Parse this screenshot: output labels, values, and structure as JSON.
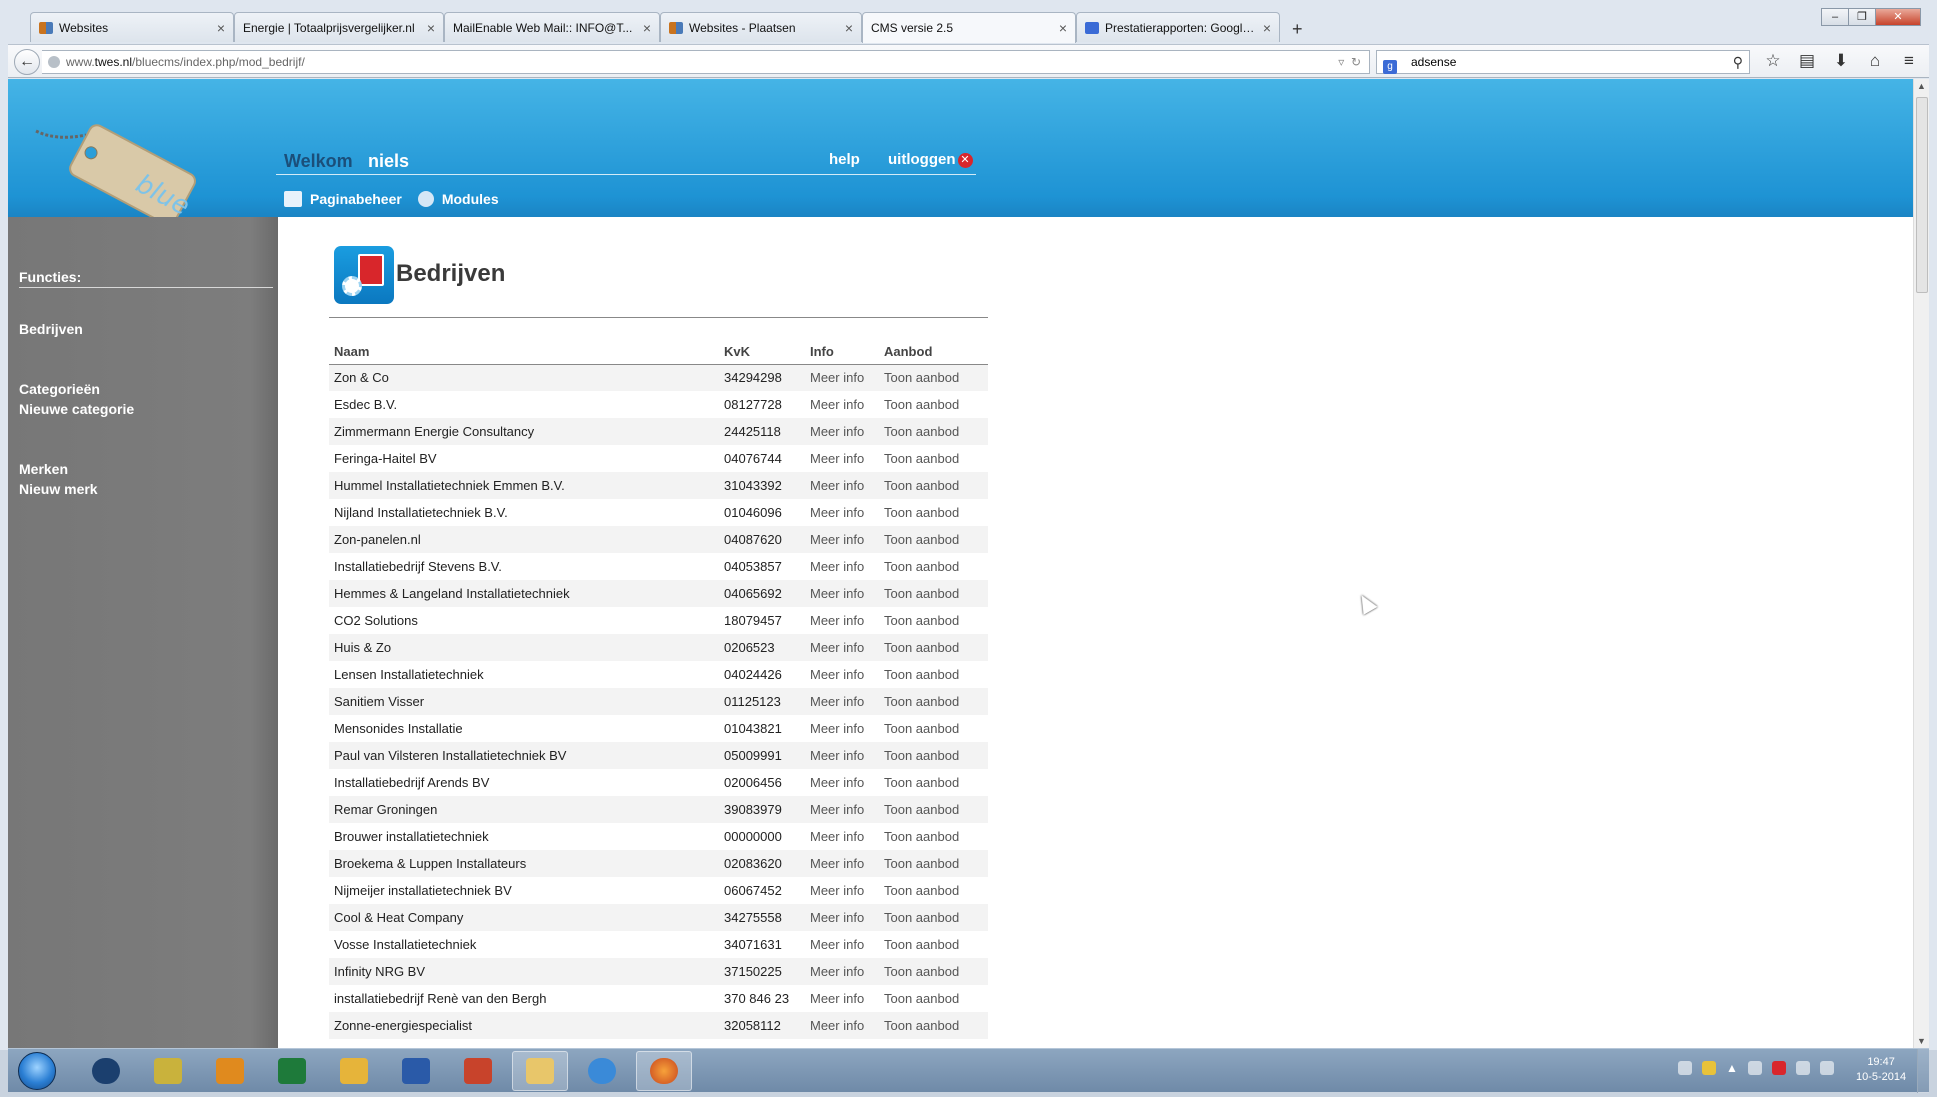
{
  "browser": {
    "tabs": [
      {
        "label": "Websites",
        "icon": "sites-favicon-icon",
        "active": false
      },
      {
        "label": "Energie | Totaalprijsvergelijker.nl",
        "icon": "",
        "active": false
      },
      {
        "label": "MailEnable Web Mail:: INFO@T...",
        "icon": "",
        "active": false
      },
      {
        "label": "Websites - Plaatsen",
        "icon": "sites-favicon-icon",
        "active": false
      },
      {
        "label": "CMS versie 2.5",
        "icon": "",
        "active": true
      },
      {
        "label": "Prestatierapporten: Google...",
        "icon": "google-favicon-icon",
        "active": false
      }
    ],
    "url_prefix": "www.",
    "url_domain": "twes.nl",
    "url_path": "/bluecms/index.php/mod_bedrijf/",
    "search_value": "adsense"
  },
  "cms": {
    "welcome_label": "Welkom",
    "user_name": "niels",
    "help_label": "help",
    "logout_label": "uitloggen",
    "nav": [
      {
        "label": "Paginabeheer",
        "icon": "pages-icon"
      },
      {
        "label": "Modules",
        "icon": "modules-gear-icon"
      }
    ],
    "sidebar": {
      "heading": "Functies:",
      "links": [
        "Bedrijven",
        "Categorieën",
        "Nieuwe categorie",
        "Merken",
        "Nieuw merk"
      ]
    },
    "page_title": "Bedrijven",
    "table": {
      "columns": [
        "Naam",
        "KvK",
        "Info",
        "Aanbod"
      ],
      "info_link": "Meer info",
      "offer_link": "Toon aanbod",
      "rows": [
        {
          "name": "Zon & Co",
          "kvk": "34294298"
        },
        {
          "name": "Esdec B.V.",
          "kvk": "08127728"
        },
        {
          "name": "Zimmermann Energie Consultancy",
          "kvk": "24425118"
        },
        {
          "name": "Feringa-Haitel BV",
          "kvk": "04076744"
        },
        {
          "name": "Hummel Installatietechniek Emmen B.V.",
          "kvk": "31043392"
        },
        {
          "name": "Nijland Installatietechniek B.V.",
          "kvk": "01046096"
        },
        {
          "name": "Zon-panelen.nl",
          "kvk": "04087620"
        },
        {
          "name": "Installatiebedrijf Stevens B.V.",
          "kvk": "04053857"
        },
        {
          "name": "Hemmes & Langeland Installatietechniek",
          "kvk": "04065692"
        },
        {
          "name": "CO2 Solutions",
          "kvk": "18079457"
        },
        {
          "name": "Huis & Zo",
          "kvk": "0206523"
        },
        {
          "name": "Lensen Installatietechniek",
          "kvk": "04024426"
        },
        {
          "name": "Sanitiem Visser",
          "kvk": "01125123"
        },
        {
          "name": "Mensonides Installatie",
          "kvk": "01043821"
        },
        {
          "name": "Paul van Vilsteren Installatietechniek BV",
          "kvk": "05009991"
        },
        {
          "name": "Installatiebedrijf Arends BV",
          "kvk": "02006456"
        },
        {
          "name": "Remar Groningen",
          "kvk": "39083979"
        },
        {
          "name": "Brouwer installatietechniek",
          "kvk": "00000000"
        },
        {
          "name": "Broekema & Luppen Installateurs",
          "kvk": "02083620"
        },
        {
          "name": "Nijmeijer installatietechniek BV",
          "kvk": "06067452"
        },
        {
          "name": "Cool & Heat Company",
          "kvk": "34275558"
        },
        {
          "name": "Vosse Installatietechniek",
          "kvk": "34071631"
        },
        {
          "name": "Infinity NRG BV",
          "kvk": "37150225"
        },
        {
          "name": "installatiebedrijf Renè van den Bergh",
          "kvk": "370 846 23"
        },
        {
          "name": "Zonne-energiespecialist",
          "kvk": "32058112"
        }
      ]
    }
  },
  "taskbar": {
    "time": "19:47",
    "date": "10-5-2014"
  },
  "colors": {
    "header_blue": "#1e93d4",
    "sidebar_grey": "#7d7d7d",
    "logout_red": "#d9262c"
  }
}
